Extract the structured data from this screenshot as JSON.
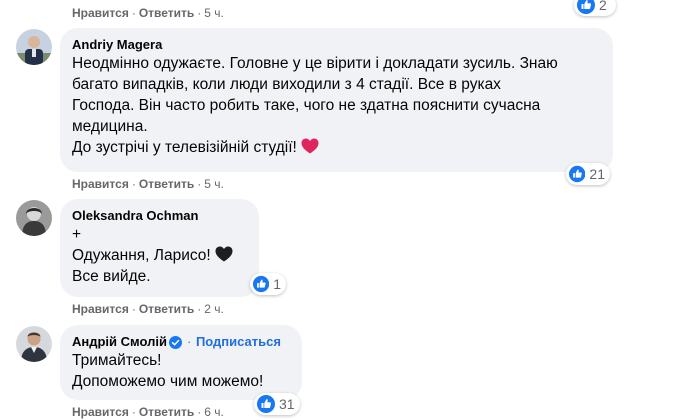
{
  "labels": {
    "like": "Нравится",
    "reply": "Ответить",
    "separator": "·"
  },
  "comments": [
    {
      "author": "",
      "lines": [],
      "time": "5 ч.",
      "reactions": "2"
    },
    {
      "author": "Andriy Magera",
      "lines": [
        "Неодмінно одужаєте. Головне у це вірити і докладати зусиль. Знаю",
        "багато випадків, коли люди виходили з 4 стадії. Все в руках",
        "Господа. Він часто робить таке, чого не здатна пояснити сучасна",
        "медицина.",
        "До зустрічі у телевізійній студії!"
      ],
      "emoji": "red-heart",
      "time": "5 ч.",
      "reactions": "21"
    },
    {
      "author": "Oleksandra Ochman",
      "lines": [
        "+",
        "Одужання, Ларисо!",
        "Все вийде."
      ],
      "emoji": "black-heart",
      "time": "2 ч.",
      "reactions": "1"
    },
    {
      "author": "Андрій Смолій",
      "verified": true,
      "follow": "Подписаться",
      "lines": [
        "Тримайтесь!",
        "Допоможемо чим можемо!"
      ],
      "time": "6 ч.",
      "reactions": "31"
    }
  ],
  "colors": {
    "bubble": "#f0f2f5",
    "meta": "#65676b",
    "like_blue": "#1877f2",
    "follow": "#216fdb",
    "red_heart": "#e0245e",
    "black_heart": "#1c1e21"
  }
}
